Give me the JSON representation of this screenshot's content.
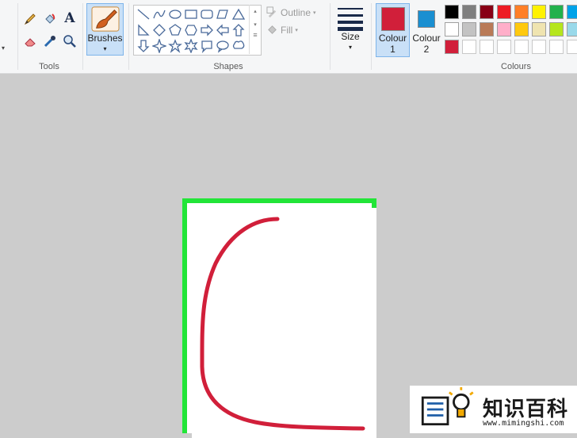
{
  "ribbon": {
    "groups": {
      "tools": "Tools",
      "shapes": "Shapes",
      "colours": "Colours"
    },
    "brushes_label": "Brushes",
    "outline_label": "Outline",
    "fill_label": "Fill",
    "size_label": "Size",
    "colour1_label": "Colour",
    "colour1_num": "1",
    "colour2_label": "Colour",
    "colour2_num": "2",
    "text_tool_glyph": "A"
  },
  "colours": {
    "colour1": "#d11f3a",
    "colour2": "#1a8fd1",
    "palette_row1": [
      "#000000",
      "#7f7f7f",
      "#880015",
      "#ed1c24",
      "#ff7f27",
      "#fff200",
      "#22b14c",
      "#00a2e8"
    ],
    "palette_row2": [
      "#ffffff",
      "#c3c3c3",
      "#b97a57",
      "#ffaec9",
      "#ffc90e",
      "#efe4b0",
      "#b5e61d",
      "#99d9ea"
    ],
    "palette_row3": [
      "#d11f3a",
      "",
      "",
      "",
      "",
      "",
      "",
      ""
    ],
    "selection_border": "#22e538",
    "stroke": "#d11f3a"
  },
  "watermark": {
    "title": "知识百科",
    "url": "www.mimingshi.com"
  }
}
